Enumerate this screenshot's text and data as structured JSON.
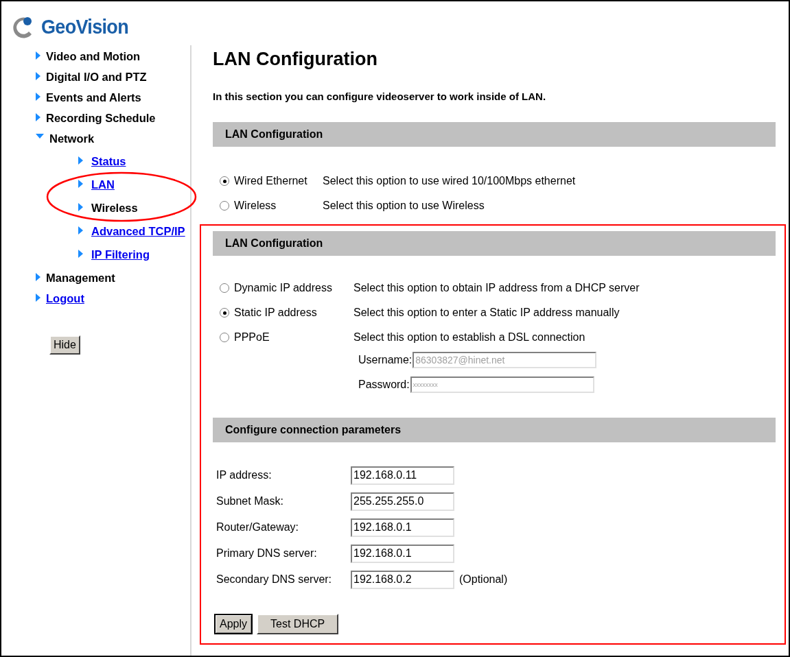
{
  "logo": {
    "text": "GeoVision"
  },
  "sidebar": {
    "items": [
      {
        "label": "Video and Motion",
        "link": false,
        "expanded": false
      },
      {
        "label": "Digital I/O and PTZ",
        "link": false,
        "expanded": false
      },
      {
        "label": "Events and Alerts",
        "link": false,
        "expanded": false
      },
      {
        "label": "Recording Schedule",
        "link": false,
        "expanded": false
      },
      {
        "label": "Network",
        "link": false,
        "expanded": true,
        "children": [
          {
            "label": "Status",
            "link": true
          },
          {
            "label": "LAN",
            "link": true
          },
          {
            "label": "Wireless",
            "link": false
          },
          {
            "label": "Advanced TCP/IP",
            "link": true
          },
          {
            "label": "IP Filtering",
            "link": true
          }
        ]
      },
      {
        "label": "Management",
        "link": false,
        "expanded": false
      },
      {
        "label": "Logout",
        "link": true,
        "expanded": false
      }
    ],
    "hide_button": "Hide"
  },
  "main": {
    "title": "LAN Configuration",
    "intro": "In this section you can configure videoserver to work inside of LAN.",
    "connection": {
      "header": "LAN Configuration",
      "options": [
        {
          "label": "Wired Ethernet",
          "description": "Select this option to use wired 10/100Mbps ethernet",
          "selected": true
        },
        {
          "label": "Wireless",
          "description": "Select this option to use Wireless",
          "selected": false
        }
      ]
    },
    "ip_mode": {
      "header": "LAN Configuration",
      "options": [
        {
          "label": "Dynamic IP address",
          "description": "Select this option to obtain IP address from a DHCP server",
          "selected": false
        },
        {
          "label": "Static IP address",
          "description": "Select this option to enter a Static IP address manually",
          "selected": true
        },
        {
          "label": "PPPoE",
          "description": "Select this option to establish a DSL connection",
          "selected": false
        }
      ],
      "credentials": [
        {
          "label": "Username:",
          "value": "86303827@hinet.net",
          "disabled": true
        },
        {
          "label": "Password:",
          "value": "xxxxxxxx",
          "disabled": true
        }
      ]
    },
    "parameters": {
      "header": "Configure connection parameters",
      "fields": [
        {
          "label": "IP address:",
          "value": "192.168.0.11"
        },
        {
          "label": "Subnet Mask:",
          "value": "255.255.255.0"
        },
        {
          "label": "Router/Gateway:",
          "value": "192.168.0.1"
        },
        {
          "label": "Primary DNS server:",
          "value": "192.168.0.1"
        },
        {
          "label": "Secondary DNS server:",
          "value": "192.168.0.2",
          "note": "(Optional)"
        }
      ]
    },
    "buttons": [
      {
        "label": "Apply",
        "default": true
      },
      {
        "label": "Test DHCP",
        "default": false
      }
    ]
  }
}
